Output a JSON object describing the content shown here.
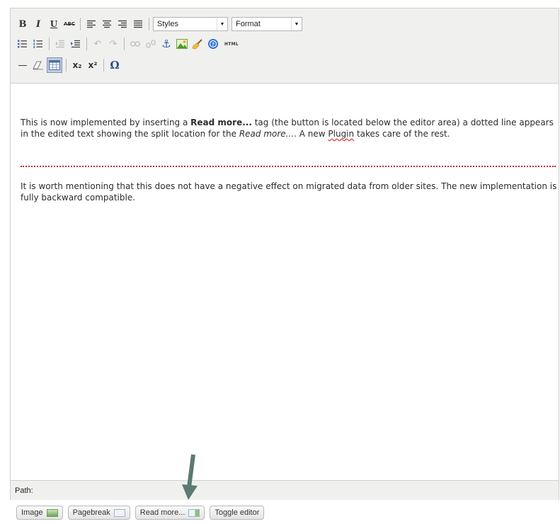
{
  "toolbar": {
    "row1": {
      "bold": "B",
      "italic": "I",
      "underline": "U",
      "strikethrough": "ABC",
      "styles_label": "Styles",
      "format_label": "Format"
    },
    "row2": {
      "html_label": "HTML"
    },
    "row3": {
      "hr_glyph": "—",
      "subscript": "x₂",
      "superscript": "x²",
      "charmap": "Ω"
    }
  },
  "content": {
    "para1": {
      "before": "This is now implemented by inserting a ",
      "bold": "Read more...",
      "middle": " tag (the button is located below the editor area) a dotted line appears in the edited text showing the split location for the ",
      "italic": "Read more...",
      "after_italic": ". A new ",
      "plugin_word": "Plugin",
      "end": " takes care of the rest."
    },
    "para2": "It is worth mentioning that this does not have a negative effect on migrated data from older sites. The new implementation is fully backward compatible."
  },
  "status": {
    "path_label": "Path:"
  },
  "bottom_buttons": {
    "image": "Image",
    "pagebreak": "Pagebreak",
    "readmore": "Read more...",
    "toggle": "Toggle editor"
  },
  "colors": {
    "toolbar_bg": "#f0f0ee",
    "readmore_line": "#c0272d",
    "arrow": "#5a7a72"
  }
}
